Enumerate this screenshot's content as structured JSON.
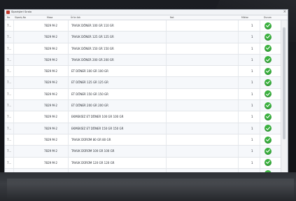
{
  "window": {
    "title": "Siparişleri Sırala",
    "close_glyph": "×"
  },
  "columns": {
    "id": "No",
    "code": "Sipariş No",
    "variant": "Masa",
    "name": "Ürün Adı",
    "note": "Not",
    "qty": "Miktar",
    "status": "Durum"
  },
  "rows": [
    {
      "id": "7...",
      "variant": "7829 M-2",
      "name": "TAVUK DÖNER 100 GR 110 GR",
      "qty": "1"
    },
    {
      "id": "7...",
      "variant": "7829 M-2",
      "name": "TAVUK DÖNER 125 GR 125 GR",
      "qty": "1"
    },
    {
      "id": "7...",
      "variant": "7829 M-2",
      "name": "TAVUK DÖNER 150 GR 150 GR",
      "qty": "1"
    },
    {
      "id": "7...",
      "variant": "7829 M-2",
      "name": "TAVUK DÖNER 200 GR 200 GR",
      "qty": "1"
    },
    {
      "id": "7...",
      "variant": "7829 M-2",
      "name": "ET DÖNER 100 GR 100 GR",
      "qty": "1"
    },
    {
      "id": "7...",
      "variant": "7829 M-2",
      "name": "ET DÖNER 125 GR 125 GR",
      "qty": "1"
    },
    {
      "id": "7...",
      "variant": "7829 M-2",
      "name": "ET DÖNER 150 GR 150 GR",
      "qty": "1"
    },
    {
      "id": "7...",
      "variant": "7829 M-2",
      "name": "ET DÖNER 200 GR 200 GR",
      "qty": "1"
    },
    {
      "id": "7...",
      "variant": "7829 M-2",
      "name": "EKMEKSİZ ET DÖNER 100 GR 100 GR",
      "qty": "1"
    },
    {
      "id": "7...",
      "variant": "7829 M-2",
      "name": "EKMEKSİZ ET DÖNER 150 GR 150 GR",
      "qty": "1"
    },
    {
      "id": "7...",
      "variant": "7829 M-2",
      "name": "TAVUK DÜRÜM 80 GR 80 GR",
      "qty": "1"
    },
    {
      "id": "7...",
      "variant": "7829 M-2",
      "name": "TAVUK DÜRÜM 100 GR 100 GR",
      "qty": "1"
    },
    {
      "id": "7...",
      "variant": "7829 M-2",
      "name": "TAVUK DÜRÜM 120 GR 120 GR",
      "qty": "1"
    },
    {
      "id": "7...",
      "variant": "7829 M-2",
      "name": "TAVUK DÜRÜM 200 GR 200 GR",
      "qty": "1"
    }
  ],
  "status_icon": "check-circle-icon",
  "colors": {
    "check_green": "#3bb13f",
    "bezel": "#15171b"
  }
}
